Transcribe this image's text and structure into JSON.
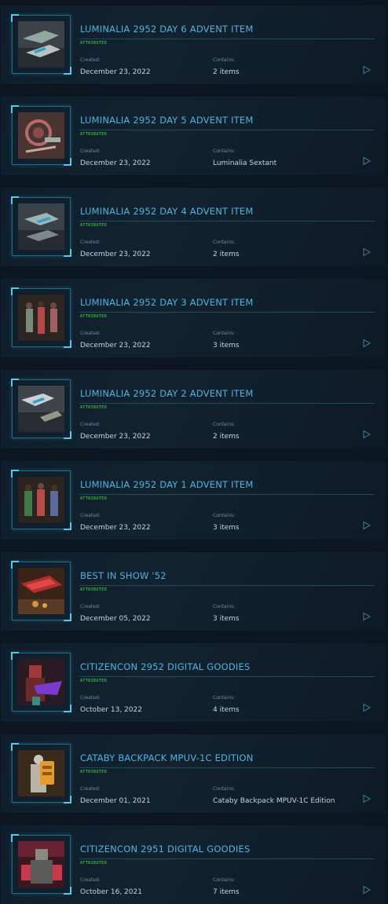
{
  "labels": {
    "badge": "ATTRIBUTED",
    "created": "Created:",
    "contains": "Contains:"
  },
  "colors": {
    "title": "#4fb3e2",
    "badge": "#3ee14c",
    "frame": "#5cc8e8",
    "background": "#0b1621"
  },
  "items": [
    {
      "title": "LUMINALIA 2952 DAY 6 ADVENT ITEM",
      "created": "December 23, 2022",
      "contains": "2 items",
      "thumb": "ships-thumbnail"
    },
    {
      "title": "LUMINALIA 2952 DAY 5 ADVENT ITEM",
      "created": "December 23, 2022",
      "contains": "Luminalia Sextant",
      "thumb": "sextant-thumbnail"
    },
    {
      "title": "LUMINALIA 2952 DAY 4 ADVENT ITEM",
      "created": "December 23, 2022",
      "contains": "2 items",
      "thumb": "ships-thumbnail"
    },
    {
      "title": "LUMINALIA 2952 DAY 3 ADVENT ITEM",
      "created": "December 23, 2022",
      "contains": "3 items",
      "thumb": "outfits-thumbnail"
    },
    {
      "title": "LUMINALIA 2952 DAY 2 ADVENT ITEM",
      "created": "December 23, 2022",
      "contains": "2 items",
      "thumb": "ships-thumbnail"
    },
    {
      "title": "LUMINALIA 2952 DAY 1 ADVENT ITEM",
      "created": "December 23, 2022",
      "contains": "3 items",
      "thumb": "outfits-thumbnail"
    },
    {
      "title": "BEST IN SHOW '52",
      "created": "December 05, 2022",
      "contains": "3 items",
      "thumb": "trophy-thumbnail"
    },
    {
      "title": "CITIZENCON 2952 DIGITAL GOODIES",
      "created": "October 13, 2022",
      "contains": "4 items",
      "thumb": "armor-thumbnail"
    },
    {
      "title": "CATABY BACKPACK MPUV-1C EDITION",
      "created": "December 01, 2021",
      "contains": "Cataby Backpack MPUV-1C Edition",
      "thumb": "backpack-thumbnail"
    },
    {
      "title": "CITIZENCON 2951 DIGITAL GOODIES",
      "created": "October 16, 2021",
      "contains": "7 items",
      "thumb": "armor-thumbnail"
    }
  ]
}
